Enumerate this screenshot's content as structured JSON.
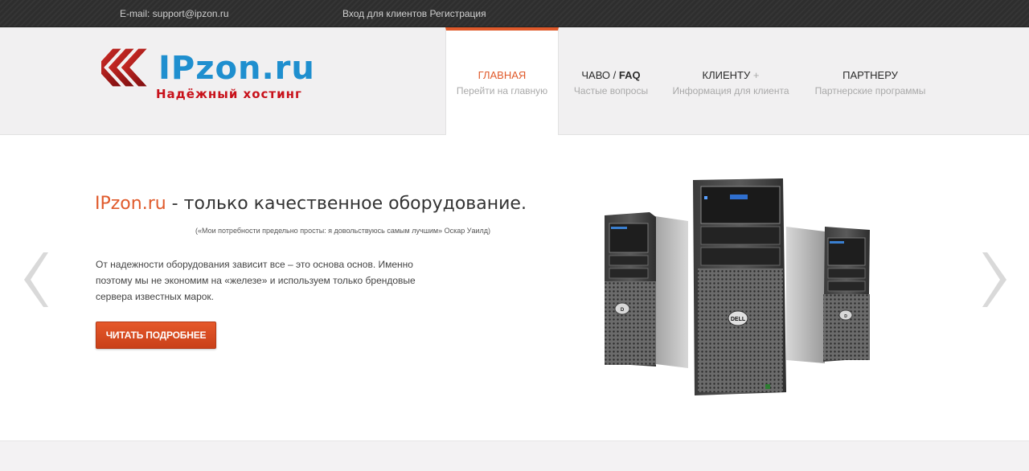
{
  "topbar": {
    "email": "E-mail: support@ipzon.ru",
    "login": "Вход для клиентов",
    "register": "Регистрация"
  },
  "logo": {
    "brand": "IPzon.ru",
    "tagline": "Надёжный хостинг"
  },
  "nav": {
    "items": [
      {
        "title": "ГЛАВНАЯ",
        "sub": "Перейти на главную",
        "active": true
      },
      {
        "title_pre": "ЧАВО / ",
        "title_bold": "FAQ",
        "sub": "Частые вопросы"
      },
      {
        "title": "КЛИЕНТУ",
        "plus": "+",
        "sub": "Информация для клиента"
      },
      {
        "title": "ПАРТНЕРУ",
        "sub": "Партнерские программы"
      }
    ]
  },
  "hero": {
    "brand": "IPzon.ru",
    "dash": " - ",
    "headline_rest": "только качественное оборудование.",
    "quote": "(«Мои потребности предельно просты: я довольствуюсь самым лучшим» Оскар Уаилд)",
    "desc": "От надежности оборудования зависит все – это основа основ. Именно поэтому мы не экономим на «железе» и используем только брендовые сервера известных марок.",
    "button": "ЧИТАТЬ ПОДРОБНЕЕ",
    "image": "dell-tower-servers",
    "server_badge": "DELL"
  },
  "icons": {
    "prev": "chevron-left-icon",
    "next": "chevron-right-icon",
    "logo": "triple-arrow-logo-icon"
  },
  "colors": {
    "accent": "#e05a2b",
    "brand_blue": "#1f8fcf",
    "brand_red": "#c8111a",
    "topbar": "#2e2e2e"
  }
}
